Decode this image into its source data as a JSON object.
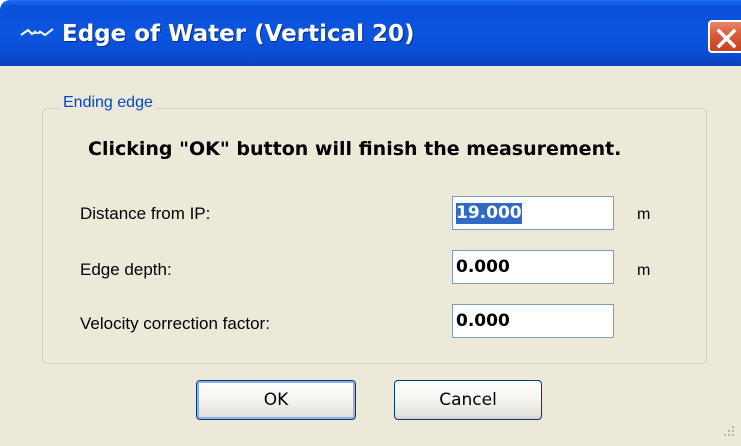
{
  "window": {
    "title": "Edge of Water (Vertical 20)",
    "icon": "river-edge-icon",
    "close_icon": "close-icon"
  },
  "group": {
    "legend": "Ending edge",
    "message": "Clicking \"OK\" button will finish the measurement."
  },
  "fields": [
    {
      "label": "Distance from IP:",
      "value": "19.000",
      "unit": "m",
      "selected": true
    },
    {
      "label": "Edge depth:",
      "value": "0.000",
      "unit": "m",
      "selected": false
    },
    {
      "label": "Velocity correction factor:",
      "value": "0.000",
      "unit": "",
      "selected": false
    }
  ],
  "buttons": {
    "ok": "OK",
    "cancel": "Cancel"
  },
  "colors": {
    "titlebar": "#0a4fd8",
    "close_button": "#d85a3a",
    "dialog_background": "#ece9d8",
    "legend_text": "#0046d5",
    "selection": "#316ac5"
  }
}
